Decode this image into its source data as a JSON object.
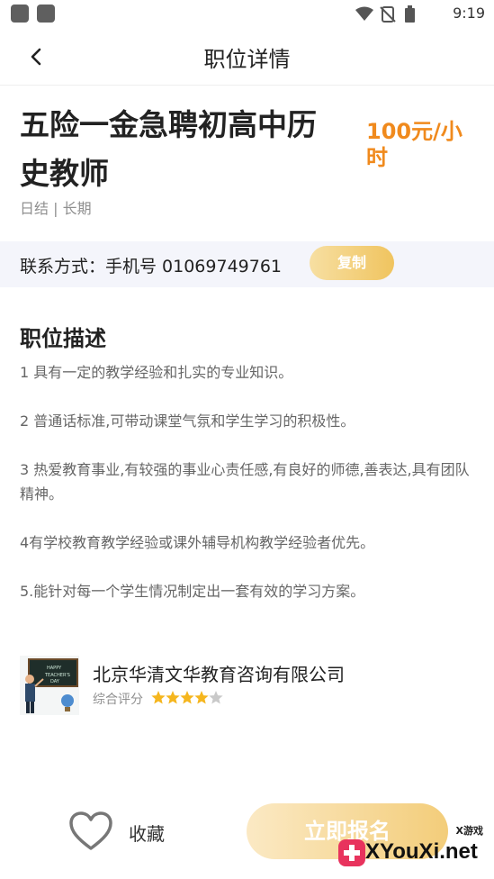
{
  "status_bar": {
    "time": "9:19"
  },
  "nav": {
    "title": "职位详情"
  },
  "job": {
    "title_line1": "五险一金急聘初高中历",
    "title_line2": "史教师",
    "salary_line1": "100元/小",
    "salary_line2": "时",
    "tags": "日结 | 长期"
  },
  "contact": {
    "text": "联系方式：手机号 01069749761",
    "copy_label": "复制"
  },
  "description": {
    "title": "职位描述",
    "items": [
      "1 具有一定的教学经验和扎实的专业知识。",
      "2 普通话标准,可带动课堂气氛和学生学习的积极性。",
      "3 热爱教育事业,有较强的事业心责任感,有良好的师德,善表达,具有团队精神。",
      "4有学校教育教学经验或课外辅导机构教学经验者优先。",
      "5.能针对每一个学生情况制定出一套有效的学习方案。"
    ]
  },
  "company": {
    "name": "北京华清文华教育咨询有限公司",
    "rating_label": "综合评分",
    "rating": 4,
    "rating_max": 5,
    "logo_board_text": "HAPPY TEACHER'S DAY"
  },
  "bottom": {
    "favorite_label": "收藏",
    "apply_label": "立即报名"
  },
  "watermark": {
    "small": "X游戏",
    "big": "XYouXi.net"
  },
  "colors": {
    "accent_orange": "#f08a1d",
    "button_gold": "#f0c45f",
    "star": "#f5b61e"
  }
}
